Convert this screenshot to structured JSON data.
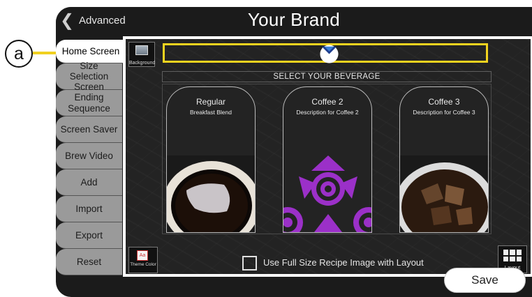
{
  "callout": {
    "label": "a"
  },
  "header": {
    "back_label": "Advanced",
    "title": "Your Brand"
  },
  "sidebar": {
    "items": [
      {
        "label": "Home Screen",
        "active": true
      },
      {
        "label": "Size Selection Screen",
        "active": false
      },
      {
        "label": "Ending Sequence",
        "active": false
      },
      {
        "label": "Screen Saver",
        "active": false
      },
      {
        "label": "Brew Video",
        "active": false
      },
      {
        "label": "Add",
        "active": false
      },
      {
        "label": "Import",
        "active": false
      },
      {
        "label": "Export",
        "active": false
      },
      {
        "label": "Reset",
        "active": false
      }
    ]
  },
  "canvas": {
    "background_button_label": "Background",
    "beverage_header": "SELECT YOUR BEVERAGE",
    "products": [
      {
        "name": "Regular",
        "description": "Breakfast Blend",
        "image": "black-coffee-cup"
      },
      {
        "name": "Coffee 2",
        "description": "Description for Coffee 2",
        "image": "purple-spiral-pattern"
      },
      {
        "name": "Coffee 3",
        "description": "Description for Coffee 3",
        "image": "iced-coffee-glass"
      }
    ],
    "theme_button_label": "Theme Color",
    "theme_icon_text": "Aa",
    "full_size_checkbox": {
      "label": "Use Full Size Recipe Image with Layout",
      "checked": false
    },
    "layout_button_label": "Layout"
  },
  "footer": {
    "save_label": "Save"
  },
  "colors": {
    "highlight": "#f2d31f",
    "accent_purple": "#9b30c8",
    "frame": "#1b1b1b",
    "tab_inactive": "#9a9a9a"
  }
}
